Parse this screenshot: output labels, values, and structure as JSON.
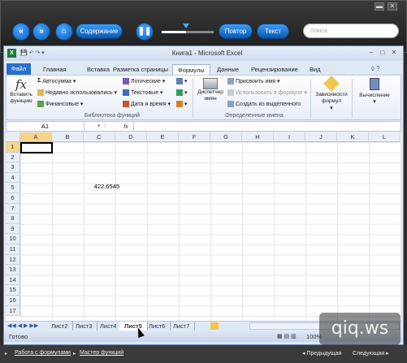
{
  "player": {
    "win_minimize": "▬",
    "win_close": "✕",
    "btn_back": "«",
    "btn_forward": "»",
    "btn_home": "⌂",
    "contents_label": "Содержание",
    "pause": "❚❚",
    "repeat_label": "Повтор",
    "text_label": "Текст",
    "search_placeholder": "поиск"
  },
  "excel": {
    "title": "Книга1 - Microsoft Excel",
    "tabs": [
      "Файл",
      "Главная",
      "Вставка",
      "Разметка страницы",
      "Формулы",
      "Данные",
      "Рецензирование",
      "Вид"
    ],
    "active_tab": "Формулы",
    "ribbon": {
      "insert_function": "Вставить функцию",
      "autosum": "Автосумма",
      "recent": "Недавно использовались",
      "financial": "Финансовые",
      "logical": "Логические",
      "text": "Текстовые",
      "datetime": "Дата и время",
      "group_library": "Библиотека функций",
      "name_manager": "Диспетчер имен",
      "assign_name": "Присвоить имя",
      "use_in_formula": "Использовать в формуле",
      "create_from_selection": "Создать из выделенного",
      "group_names": "Определенные имена",
      "dependencies": "Зависимости формул",
      "calculation": "Вычисление"
    },
    "formula_bar": {
      "name_box": "A1",
      "fx": "fx"
    },
    "columns": [
      "A",
      "B",
      "C",
      "D",
      "E",
      "F",
      "G",
      "H",
      "I",
      "J",
      "K",
      "L"
    ],
    "rows": [
      "1",
      "2",
      "3",
      "4",
      "5",
      "6",
      "7",
      "8",
      "9",
      "10",
      "11",
      "12",
      "13",
      "14",
      "15",
      "16",
      "17"
    ],
    "cell_c5": "422,6545",
    "sheets": [
      "Лист2",
      "Лист3",
      "Лист4",
      "Лист5",
      "Лист6",
      "Лист7"
    ],
    "active_sheet": "Лист5",
    "status_ready": "Готово",
    "zoom": "100%"
  },
  "bottom": {
    "crumb1": "Работа с формулами",
    "crumb2": "Мастер функций",
    "prev": "Предыдущая",
    "next": "Следующая"
  },
  "watermark": "qiq.ws"
}
